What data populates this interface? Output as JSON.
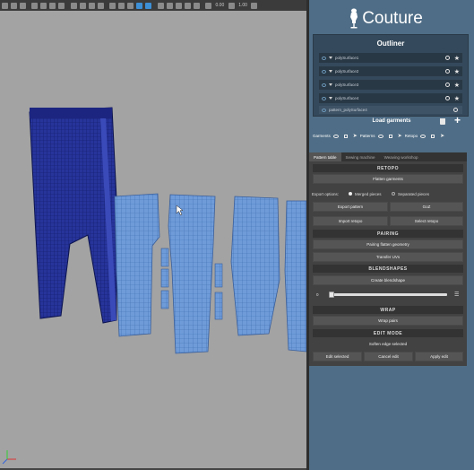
{
  "toolbar": {
    "value_left": "0.00",
    "value_right": "1.00"
  },
  "brand": {
    "name": "Couture"
  },
  "outliner": {
    "title": "Outliner",
    "items": [
      {
        "label": "polySurface1",
        "selected": false
      },
      {
        "label": "polySurface2",
        "selected": false
      },
      {
        "label": "polySurface3",
        "selected": false
      },
      {
        "label": "polySurface4",
        "selected": false
      },
      {
        "label": "pattern_polySurface4",
        "selected": true
      }
    ]
  },
  "load_garments": {
    "title": "Load garments",
    "row_labels": {
      "garments": "Garments",
      "patterns": "Patterns",
      "retopo": "Retopo"
    }
  },
  "tabs": [
    {
      "label": "Pattern table",
      "active": true
    },
    {
      "label": "Sewing machine",
      "active": false
    },
    {
      "label": "Weaving workshop",
      "active": false
    }
  ],
  "retopo": {
    "header": "RETOPO",
    "flatten_button": "Flatten garments",
    "export_options_label": "Export options:",
    "merged_pieces": "Merged pieces",
    "separated_pieces": "Separated pieces",
    "export_pattern": "Export pattern",
    "goz": "GoZ",
    "import_retopo": "Import retopo",
    "select_retopo": "Select retopo"
  },
  "pairing": {
    "header": "PAIRING",
    "pair_button": "Pairing flatten geometry",
    "transfer_button": "Transfer UVs"
  },
  "blendshapes": {
    "header": "BLENDSHAPES",
    "create_button": "Create blendshape",
    "slider_value": "0",
    "slider_fraction": 0.0
  },
  "wrap": {
    "header": "WRAP",
    "wrap_button": "Wrap pairs"
  },
  "edit_mode": {
    "header": "EDIT MODE",
    "soften_label": "Soften edge selected",
    "edit_selected": "Edit selected",
    "cancel_edit": "Cancel edit",
    "apply_edit": "Apply edit"
  },
  "colors": {
    "viewport_bg": "#a3a3a3",
    "panel_bg": "#4f6d86",
    "mesh_dark_blue": "#1d2a8a",
    "mesh_light_blue": "#6a96d6"
  }
}
